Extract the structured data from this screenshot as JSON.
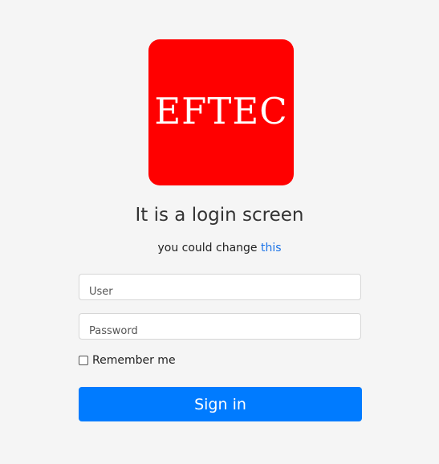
{
  "logo": {
    "text": "EFTEC"
  },
  "title": "It is a login screen",
  "subtitle": {
    "prefix": "you could change",
    "link_text": "this"
  },
  "form": {
    "user_placeholder": "User",
    "password_placeholder": "Password",
    "remember_label": "Remember me",
    "remember_checked": false,
    "submit_label": "Sign in"
  },
  "colors": {
    "background": "#f5f5f5",
    "logo_bg": "#ff0000",
    "accent": "#007bff",
    "link": "#1a73e8"
  }
}
